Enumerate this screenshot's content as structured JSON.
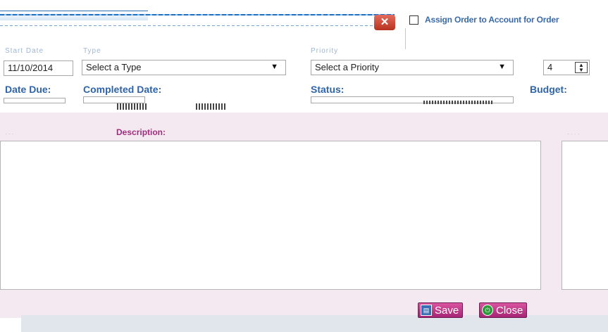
{
  "header": {
    "assign_label": "Assign Order to Account for Order"
  },
  "fields": {
    "start_date_label": "Start Date",
    "start_date_value": "11/10/2014",
    "type_label": "Type",
    "type_placeholder": "Select a Type",
    "priority_label": "Priority",
    "priority_placeholder": "Select a Priority",
    "spin_value": "4",
    "date_due_label": "Date Due:",
    "completed_date_label": "Completed Date:",
    "status_label": "Status:",
    "budget_label": "Budget:"
  },
  "main": {
    "description_label": "Description:"
  },
  "buttons": {
    "save_label": "Save",
    "close_label": "Close"
  },
  "colors": {
    "label_blue": "#2f64a8",
    "panel_pink": "#f4e9f1",
    "button_magenta": "#a72476",
    "close_red": "#b6321f"
  }
}
